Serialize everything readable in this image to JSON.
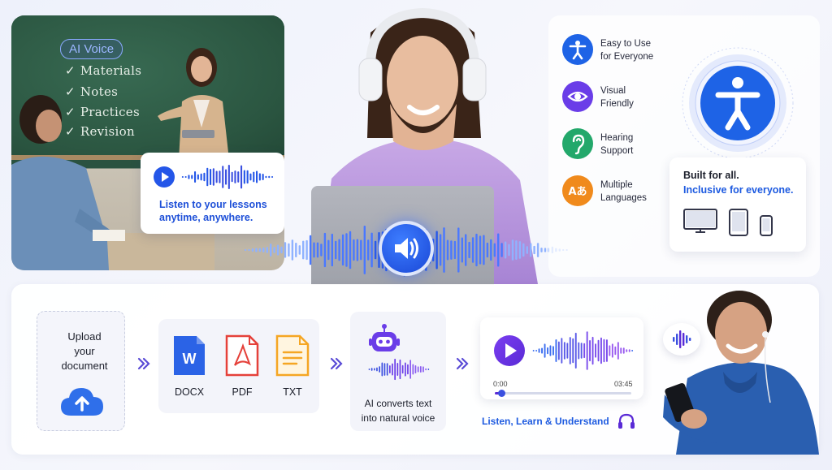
{
  "classroom": {
    "badge": "AI Voice",
    "items": [
      "Materials",
      "Notes",
      "Practices",
      "Revision"
    ],
    "tick": "✓"
  },
  "listen_card": {
    "line1": "Listen to your lessons",
    "line2": "anytime, anywhere."
  },
  "features": [
    {
      "line1": "Easy to Use",
      "line2": "for Everyone",
      "icon": "accessibility-icon",
      "color": "#1e63e6"
    },
    {
      "line1": "Visual",
      "line2": "Friendly",
      "icon": "eye-icon",
      "color": "#6a3de8"
    },
    {
      "line1": "Hearing",
      "line2": "Support",
      "icon": "ear-icon",
      "color": "#23a86b"
    },
    {
      "line1": "Multiple",
      "line2": "Languages",
      "icon": "translate-icon",
      "color": "#f08a1c"
    }
  ],
  "translate_glyph": "Aあ",
  "built_card": {
    "line1": "Built for all.",
    "line2": "Inclusive for everyone."
  },
  "workflow": {
    "upload": {
      "line1": "Upload",
      "line2": "your",
      "line3": "document"
    },
    "files": [
      {
        "label": "DOCX",
        "letter": "W",
        "color": "#2b63e6"
      },
      {
        "label": "PDF",
        "color": "#e5413a"
      },
      {
        "label": "TXT",
        "color": "#f5a623"
      }
    ],
    "ai": {
      "line1": "AI converts text",
      "line2": "into natural voice"
    },
    "player": {
      "time_start": "0:00",
      "time_end": "03:45",
      "progress": 0.05
    },
    "tagline": "Listen, Learn & Understand"
  },
  "colors": {
    "primary": "#1d5ae0",
    "violet": "#6a3de8"
  }
}
